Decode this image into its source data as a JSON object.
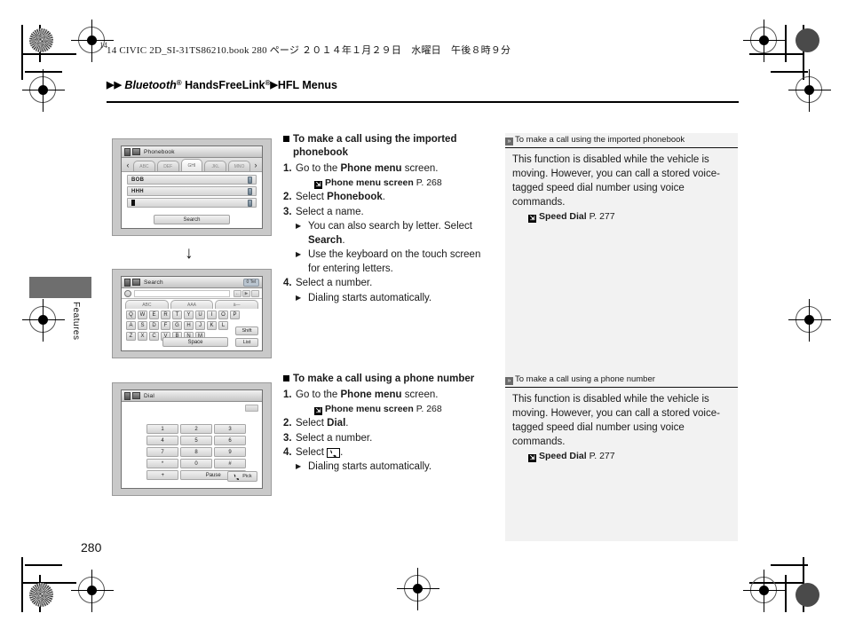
{
  "print_marks": {
    "signature_number": "14"
  },
  "header": {
    "filestamp": "14 CIVIC 2D_SI-31TS86210.book   280 ページ   ２０１４年１月２９日　水曜日　午後８時９分",
    "breadcrumb": {
      "arrow": "▶",
      "part1": "Bluetooth",
      "sup1": "®",
      "part2": " HandsFreeLink",
      "sup2": "®",
      "part3": "HFL Menus"
    }
  },
  "thumb_tab": {
    "label": "Features"
  },
  "page_number": "280",
  "screenshots": {
    "phonebook": {
      "title": "Phonebook",
      "tabs": [
        "ABC",
        "DEF",
        "GHI",
        "JKL",
        "MNO"
      ],
      "selected_tab_index": 2,
      "prev_arrow": "‹",
      "next_arrow": "›",
      "rows": [
        "BOB",
        "HHH",
        ""
      ],
      "search_button": "Search"
    },
    "search": {
      "title": "Search",
      "status_badge": "0 Tel",
      "modes": [
        "ABC",
        "AAA",
        "à—"
      ],
      "keys_row1": [
        "Q",
        "W",
        "E",
        "R",
        "T",
        "Y",
        "U",
        "I",
        "O",
        "P"
      ],
      "keys_row2": [
        "A",
        "S",
        "D",
        "F",
        "G",
        "H",
        "J",
        "K",
        "L"
      ],
      "keys_row3": [
        "Z",
        "X",
        "C",
        "V",
        "B",
        "N",
        "M"
      ],
      "space_key": "Space",
      "shift_key": "Shift",
      "list_key": "List"
    },
    "dial": {
      "title": "Dial",
      "keys": [
        [
          "1",
          "2",
          "3"
        ],
        [
          "4",
          "5",
          "6"
        ],
        [
          "7",
          "8",
          "9"
        ],
        [
          "*",
          "0",
          "#"
        ]
      ],
      "plus_key": "+",
      "pause_key": "Pause",
      "call_button": "Pick",
      "call_icon": "handset-icon"
    }
  },
  "instructions": [
    {
      "heading": "To make a call using the imported phonebook",
      "steps": [
        {
          "text_before": "Go to the ",
          "bold": "Phone menu",
          "text_after": " screen.",
          "xref": {
            "icon": "jump-to-icon",
            "label": "Phone menu screen",
            "page": "P. 268"
          }
        },
        {
          "text_before": "Select ",
          "bold": "Phonebook",
          "text_after": "."
        },
        {
          "text_before": "Select a name.",
          "bullets": [
            {
              "text_before": "You can also search by letter. Select ",
              "bold": "Search",
              "text_after": "."
            },
            {
              "text_before": "Use the keyboard on the touch screen for entering letters."
            }
          ]
        },
        {
          "text_before": "Select a number.",
          "bullets": [
            {
              "text_before": "Dialing starts automatically."
            }
          ]
        }
      ]
    },
    {
      "heading": "To make a call using a phone number",
      "steps": [
        {
          "text_before": "Go to the ",
          "bold": "Phone menu",
          "text_after": " screen.",
          "xref": {
            "icon": "jump-to-icon",
            "label": "Phone menu screen",
            "page": "P. 268"
          }
        },
        {
          "text_before": "Select ",
          "bold": "Dial",
          "text_after": "."
        },
        {
          "text_before": "Select a number."
        },
        {
          "text_before": "Select ",
          "icon": "handset-icon",
          "text_after": ".",
          "bullets": [
            {
              "text_before": "Dialing starts automatically."
            }
          ]
        }
      ]
    }
  ],
  "notes": [
    {
      "head": "To make a call using the imported phonebook",
      "body": "This function is disabled while the vehicle is moving. However, you can call a stored voice-tagged speed dial number using voice commands.",
      "xref": {
        "icon": "jump-to-icon",
        "label": "Speed Dial",
        "page": "P. 277"
      }
    },
    {
      "head": "To make a call using a phone number",
      "body": "This function is disabled while the vehicle is moving. However, you can call a stored voice-tagged speed dial number using voice commands.",
      "xref": {
        "icon": "jump-to-icon",
        "label": "Speed Dial",
        "page": "P. 277"
      }
    }
  ]
}
